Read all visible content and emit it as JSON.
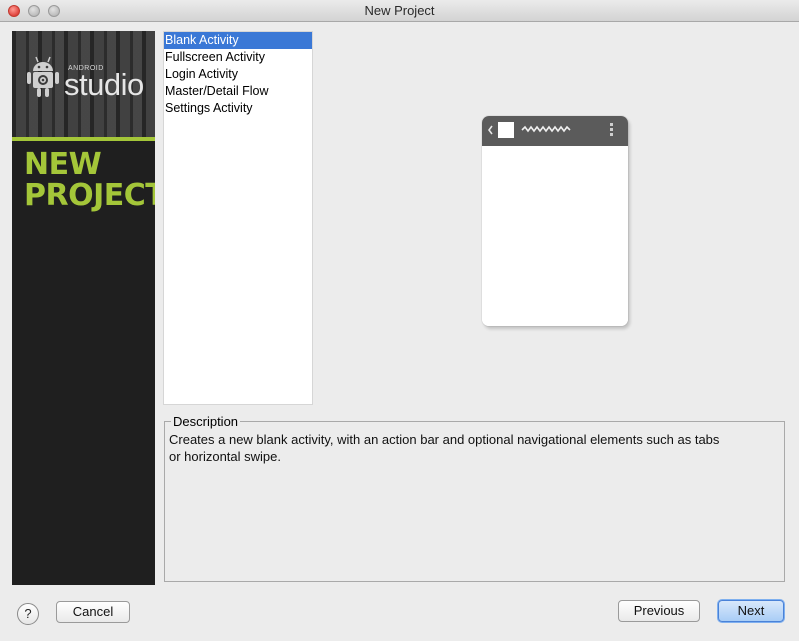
{
  "window": {
    "title": "New Project"
  },
  "sidebar": {
    "logo_small_text": "ANDROID",
    "logo_text": "studio",
    "heading_line1": "NEW",
    "heading_line2": "PROJECT",
    "accent_color": "#a4c639"
  },
  "templates": {
    "items": [
      {
        "label": "Blank Activity",
        "selected": true
      },
      {
        "label": "Fullscreen Activity",
        "selected": false
      },
      {
        "label": "Login Activity",
        "selected": false
      },
      {
        "label": "Master/Detail Flow",
        "selected": false
      },
      {
        "label": "Settings Activity",
        "selected": false
      }
    ],
    "selection_color": "#3a78d6"
  },
  "preview": {
    "icons": [
      "back-chevron-icon",
      "app-icon",
      "title-squiggle-icon",
      "overflow-menu-icon"
    ]
  },
  "description": {
    "legend": "Description",
    "text_line1": "Creates a new blank activity, with an action bar and optional navigational elements such as tabs",
    "text_line2": "or horizontal swipe."
  },
  "buttons": {
    "help_label": "?",
    "cancel_label": "Cancel",
    "previous_label": "Previous",
    "next_label": "Next"
  }
}
